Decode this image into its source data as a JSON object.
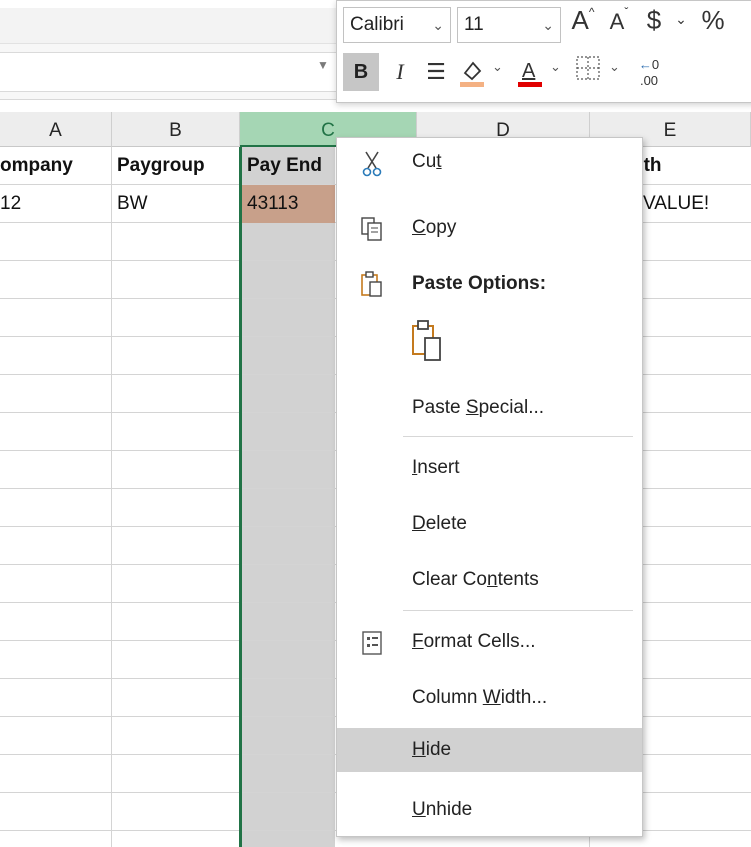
{
  "ribbon": {
    "font_name": "Calibri",
    "font_size": "11",
    "currency_symbol": "$",
    "percent_symbol": "%",
    "bold_label": "B",
    "italic_label": "I",
    "font_color_label": "A",
    "decimal_label": ".00"
  },
  "columns": {
    "headers": [
      "A",
      "B",
      "C",
      "D",
      "E"
    ],
    "selected": "C"
  },
  "cells": {
    "row1": [
      "ompany",
      "Paygroup",
      "Pay End",
      "",
      "nth"
    ],
    "row2": [
      "12",
      "BW",
      "43113",
      "",
      "VALUE!"
    ]
  },
  "context_menu": {
    "cut": {
      "pre": "Cu",
      "accel": "t",
      "post": ""
    },
    "copy": {
      "pre": "",
      "accel": "C",
      "post": "opy"
    },
    "paste_options": "Paste Options:",
    "paste_special": {
      "pre": "Paste ",
      "accel": "S",
      "post": "pecial..."
    },
    "insert": {
      "pre": "",
      "accel": "I",
      "post": "nsert"
    },
    "delete": {
      "pre": "",
      "accel": "D",
      "post": "elete"
    },
    "clear_contents": {
      "pre": "Clear Co",
      "accel": "n",
      "post": "tents"
    },
    "format_cells": {
      "pre": "",
      "accel": "F",
      "post": "ormat Cells..."
    },
    "column_width": {
      "pre": "Column ",
      "accel": "W",
      "post": "idth..."
    },
    "hide": {
      "pre": "",
      "accel": "H",
      "post": "ide"
    },
    "unhide": {
      "pre": "",
      "accel": "U",
      "post": "nhide"
    },
    "highlighted": "hide"
  },
  "colors": {
    "selection_green": "#217346",
    "header_selected": "#a5d6b4",
    "column_shade": "#d2d2d2",
    "active_cell": "#c8a08a",
    "menu_highlight": "#d1d1d1",
    "font_color_bar": "#e00000",
    "fill_color_bar": "#f4b183"
  }
}
